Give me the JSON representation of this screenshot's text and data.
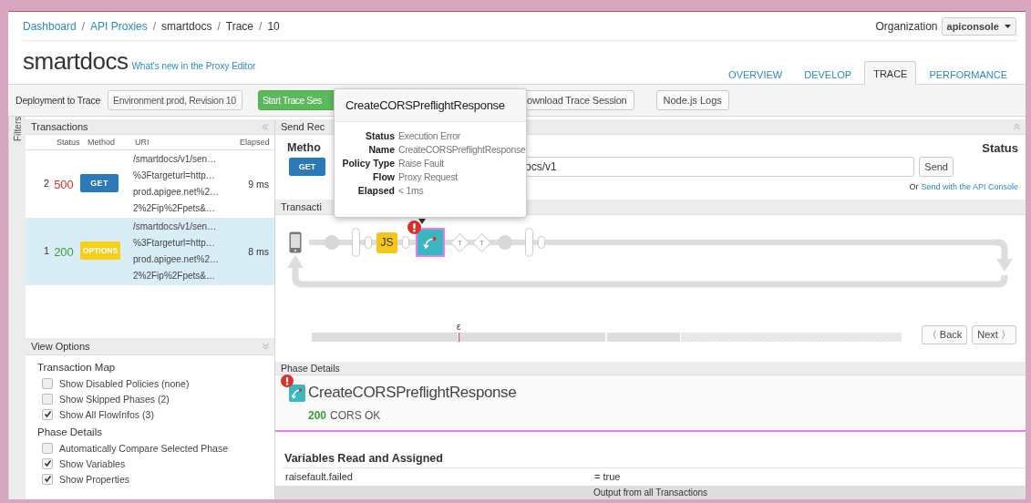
{
  "breadcrumb": {
    "separator": "/",
    "items": [
      {
        "label": "Dashboard",
        "link": true
      },
      {
        "label": "API Proxies",
        "link": true
      },
      {
        "label": "smartdocs",
        "link": false
      },
      {
        "label": "Trace",
        "link": false
      },
      {
        "label": "10",
        "link": false
      }
    ]
  },
  "organization": {
    "label": "Organization",
    "value": "apiconsole"
  },
  "title": "smartdocs",
  "whats_new": "What's new in the Proxy Editor",
  "tabs": [
    {
      "label": "OVERVIEW",
      "selected": false
    },
    {
      "label": "DEVELOP",
      "selected": false
    },
    {
      "label": "TRACE",
      "selected": true
    },
    {
      "label": "PERFORMANCE",
      "selected": false
    }
  ],
  "toolbar": {
    "deployment_label": "Deployment to Trace",
    "deployment_value": "Environment prod, Revision 10",
    "start_button": "Start Trace Ses",
    "download_button": "ownload Trace Session",
    "logs_button": "Node.js Logs"
  },
  "filters_label": "Filters",
  "transactions": {
    "title": "Transactions",
    "columns": [
      "Status",
      "Method",
      "URI",
      "Elapsed"
    ],
    "rows": [
      {
        "number": "2",
        "status": {
          "code": "500",
          "color": "#d9312b"
        },
        "method": {
          "label": "GET",
          "color": "#2a7ab9"
        },
        "uri": [
          "/smartdocs/v1/sen…",
          "%3Ftargeturl=http…",
          "prod.apigee.net%2…",
          "2%2Fip%2Fpets&…"
        ],
        "elapsed": "9 ms",
        "selected": false
      },
      {
        "number": "1",
        "status": {
          "code": "200",
          "color": "#3aa03a"
        },
        "method": {
          "label": "OPTIONS",
          "color": "#f5cf1a"
        },
        "uri": [
          "/smartdocs/v1/sen…",
          "%3Ftargeturl=http…",
          "prod.apigee.net%2…",
          "2%2Fip%2Fpets&…"
        ],
        "elapsed": "8 ms",
        "selected": true
      }
    ]
  },
  "view_options": {
    "title": "View Options",
    "groups": [
      {
        "title": "Transaction Map",
        "options": [
          {
            "label": "Show Disabled Policies (none)",
            "checked": false
          },
          {
            "label": "Show Skipped Phases (2)",
            "checked": false
          },
          {
            "label": "Show All FlowInfos (3)",
            "checked": true
          }
        ]
      },
      {
        "title": "Phase Details",
        "options": [
          {
            "label": "Automatically Compare Selected Phase",
            "checked": false
          },
          {
            "label": "Show Variables",
            "checked": true
          },
          {
            "label": "Show Properties",
            "checked": true
          }
        ]
      }
    ]
  },
  "send_request": {
    "title": "Send Rec",
    "method_label": "Metho",
    "method": "GET",
    "url": "ocs/v1",
    "send": "Send",
    "status_label": "Status",
    "alt_prefix": "Or",
    "alt_link": "Send with the API Console"
  },
  "transaction_map": {
    "title": "Transacti",
    "nodes": [
      {
        "kind": "dot"
      },
      {
        "kind": "gate"
      },
      {
        "kind": "pill"
      },
      {
        "kind": "js",
        "label": "JS"
      },
      {
        "kind": "pill"
      },
      {
        "kind": "policy",
        "selected": true,
        "error": true
      },
      {
        "kind": "condition",
        "label": "T"
      },
      {
        "kind": "condition",
        "label": "T"
      },
      {
        "kind": "dot"
      },
      {
        "kind": "gate"
      },
      {
        "kind": "pill"
      }
    ],
    "timeline_label": "ε",
    "back": "〈 Back",
    "next": "Next 〉"
  },
  "tooltip": {
    "title": "CreateCORSPreflightResponse",
    "fields": [
      {
        "label": "Status",
        "value": "Execution Error"
      },
      {
        "label": "Name",
        "value": "CreateCORSPreflightResponse"
      },
      {
        "label": "Policy Type",
        "value": "Raise Fault"
      },
      {
        "label": "Flow",
        "value": "Proxy Request"
      },
      {
        "label": "Elapsed",
        "value": "< 1ms"
      }
    ]
  },
  "phase_details": {
    "title": "Phase Details",
    "policy": "CreateCORSPreflightResponse",
    "error": true,
    "code": "200",
    "message": "CORS OK"
  },
  "variables": {
    "title": "Variables Read and Assigned",
    "rows": [
      {
        "name": "raisefault.failed",
        "value": "= true"
      }
    ]
  },
  "output_bar": "Output from all Transactions"
}
